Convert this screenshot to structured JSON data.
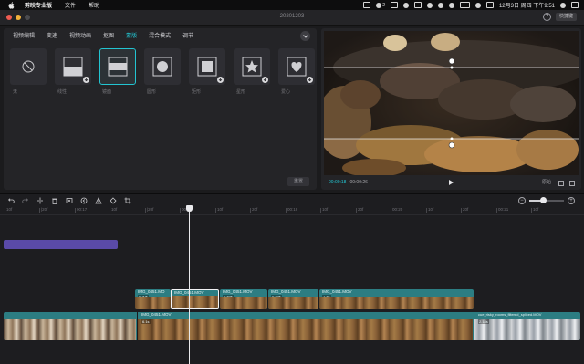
{
  "menubar": {
    "app_name": "剪映专业版",
    "items": [
      "文件",
      "帮助"
    ],
    "badge_count": "2",
    "clock": "12月3日 周四 下午9:51"
  },
  "window": {
    "title": "20201203",
    "shortcut_label": "快捷键",
    "help_icon": "?"
  },
  "panel": {
    "tabs": [
      {
        "label": "视频编辑",
        "active": false
      },
      {
        "label": "变速",
        "active": false
      },
      {
        "label": "视频动画",
        "active": false
      },
      {
        "label": "抠图",
        "active": false
      },
      {
        "label": "蒙版",
        "active": true
      },
      {
        "label": "混合模式",
        "active": false
      },
      {
        "label": "调节",
        "active": false
      }
    ],
    "masks": [
      {
        "label": "无",
        "icon": "none-icon",
        "active": false,
        "download": false
      },
      {
        "label": "线性",
        "icon": "linear-mask-icon",
        "active": false,
        "download": true
      },
      {
        "label": "镜面",
        "icon": "mirror-mask-icon",
        "active": true,
        "download": false
      },
      {
        "label": "圆形",
        "icon": "circle-mask-icon",
        "active": false,
        "download": false
      },
      {
        "label": "矩形",
        "icon": "rectangle-mask-icon",
        "active": false,
        "download": true
      },
      {
        "label": "星形",
        "icon": "star-mask-icon",
        "active": false,
        "download": true
      },
      {
        "label": "爱心",
        "icon": "heart-mask-icon",
        "active": false,
        "download": true
      }
    ],
    "reset_label": "重置"
  },
  "preview": {
    "current_time": "00:00:18",
    "total_time": "00:00:26",
    "ratio_label": "原始"
  },
  "timeline": {
    "ruler_labels": [
      "10f",
      "|20f",
      "00:17",
      "10f",
      "|20f",
      "00:18",
      "10f",
      "20f",
      "00:19",
      "10f",
      "20f",
      "00:20",
      "10f",
      "20f",
      "00:21",
      "10f"
    ],
    "overlay_clips": [
      {
        "name": "IMG_0451.MO",
        "duration": "0.30s",
        "selected": false
      },
      {
        "name": "IMG_0451.MOV",
        "duration": "0.49s",
        "selected": true
      },
      {
        "name": "IMG_0451.MOV",
        "duration": "0.49s",
        "selected": false
      },
      {
        "name": "IMG_0451.MOV",
        "duration": "0.49s",
        "selected": false
      },
      {
        "name": "IMG_0451.MOV",
        "duration": "1.4s",
        "selected": false
      }
    ],
    "main_clips": [
      {
        "name": "",
        "duration": ""
      },
      {
        "name": "IMG_0451.MOV",
        "duration": "6.1s"
      },
      {
        "name": "cue_risky_rooms_filtered_spliced.MOV",
        "duration": "2.18s"
      }
    ]
  },
  "colors": {
    "accent": "#23c4d1",
    "clip_teal": "#2c7d82",
    "audio_purple": "#5a4aa8",
    "panel_bg": "#242427",
    "app_bg": "#1b1b1d"
  }
}
